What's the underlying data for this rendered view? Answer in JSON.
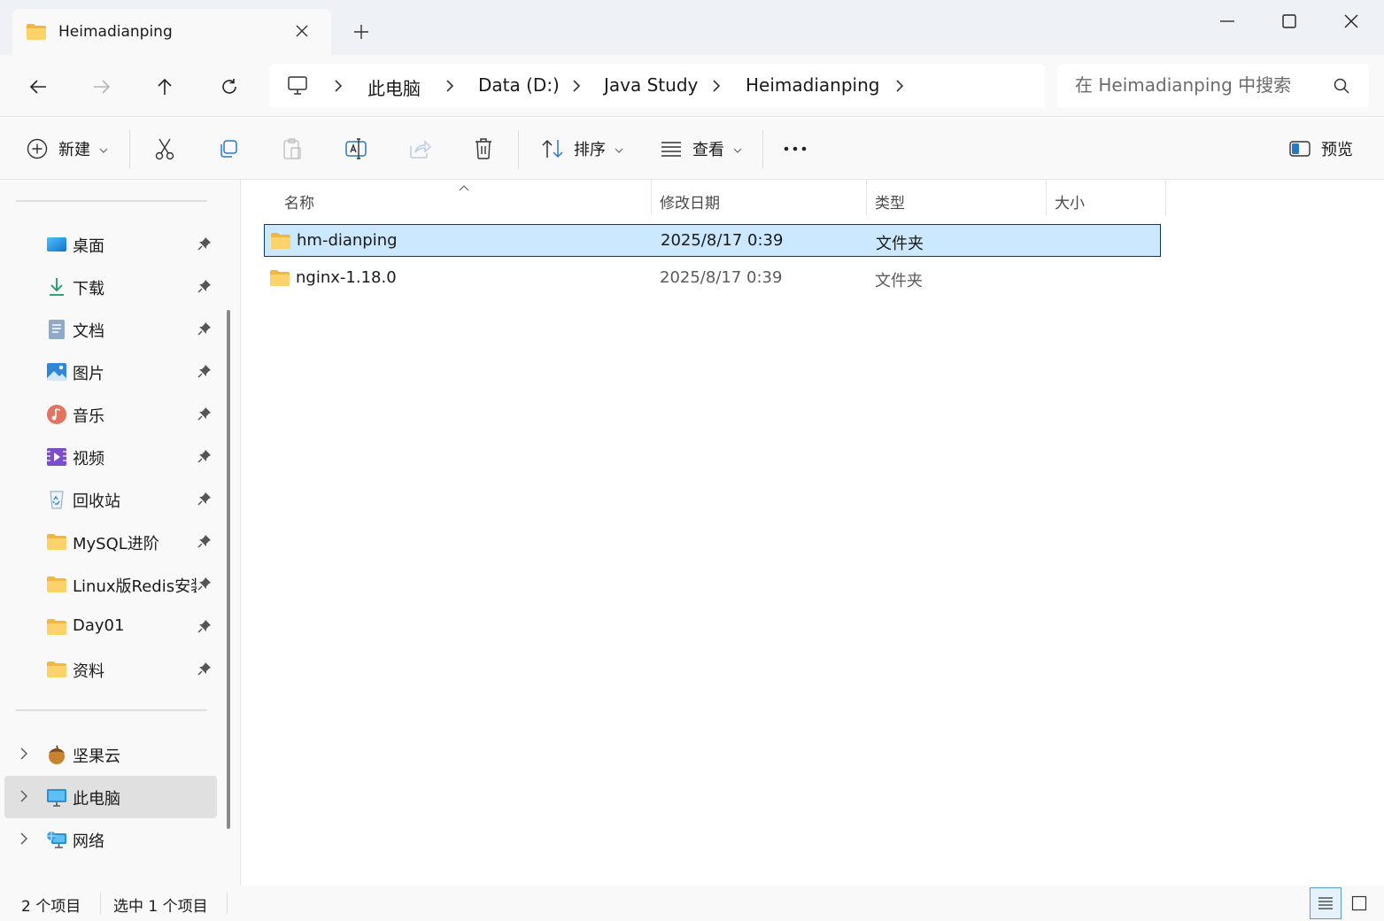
{
  "window": {
    "tab_title": "Heimadianping",
    "minimize_icon": "minimize-icon",
    "maximize_icon": "maximize-icon",
    "close_icon": "close-icon"
  },
  "address": {
    "crumbs": [
      "此电脑",
      "Data (D:)",
      "Java Study",
      "Heimadianping"
    ],
    "search_placeholder": "在 Heimadianping 中搜索"
  },
  "toolbar": {
    "new_label": "新建",
    "sort_label": "排序",
    "view_label": "查看",
    "preview_label": "预览"
  },
  "sidebar": {
    "quick_access": [
      {
        "label": "桌面",
        "icon": "desktop-icon"
      },
      {
        "label": "下载",
        "icon": "download-icon"
      },
      {
        "label": "文档",
        "icon": "documents-icon"
      },
      {
        "label": "图片",
        "icon": "pictures-icon"
      },
      {
        "label": "音乐",
        "icon": "music-icon"
      },
      {
        "label": "视频",
        "icon": "videos-icon"
      },
      {
        "label": "回收站",
        "icon": "recycle-bin-icon"
      },
      {
        "label": "MySQL进阶",
        "icon": "folder-icon"
      },
      {
        "label": "Linux版Redis安装",
        "icon": "folder-icon"
      },
      {
        "label": "Day01",
        "icon": "folder-icon"
      },
      {
        "label": "资料",
        "icon": "folder-icon"
      }
    ],
    "locations": [
      {
        "label": "坚果云",
        "icon": "nutstore-icon"
      },
      {
        "label": "此电脑",
        "icon": "this-pc-icon",
        "selected": true
      },
      {
        "label": "网络",
        "icon": "network-icon"
      }
    ]
  },
  "columns": {
    "name": "名称",
    "modified": "修改日期",
    "type": "类型",
    "size": "大小"
  },
  "files": [
    {
      "name": "hm-dianping",
      "modified": "2025/8/17 0:39",
      "type": "文件夹",
      "selected": true
    },
    {
      "name": "nginx-1.18.0",
      "modified": "2025/8/17 0:39",
      "type": "文件夹",
      "selected": false
    }
  ],
  "status": {
    "count": "2 个项目",
    "selection": "选中 1 个项目"
  },
  "colors": {
    "selection_bg": "#cce8ff",
    "selection_border": "#0a3a6a",
    "folder_yellow": "#f7c948",
    "chrome_bg": "#eef1f5"
  }
}
